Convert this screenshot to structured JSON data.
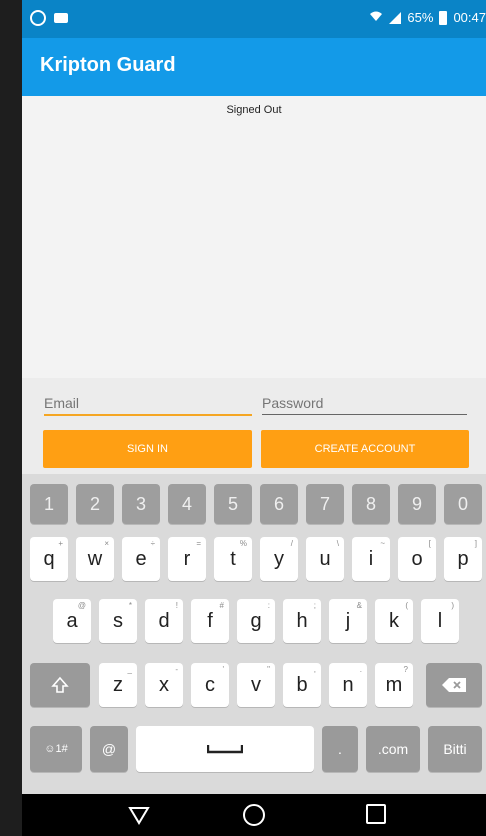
{
  "status_bar": {
    "battery": "65%",
    "time": "00:47"
  },
  "app_bar": {
    "title": "Kripton Guard"
  },
  "content": {
    "status_text": "Signed Out"
  },
  "form": {
    "email_placeholder": "Email",
    "password_placeholder": "Password",
    "sign_in_label": "SIGN IN",
    "create_account_label": "CREATE ACCOUNT"
  },
  "keyboard": {
    "numbers": [
      "1",
      "2",
      "3",
      "4",
      "5",
      "6",
      "7",
      "8",
      "9",
      "0"
    ],
    "row1": [
      {
        "key": "q",
        "hint": "+"
      },
      {
        "key": "w",
        "hint": "×"
      },
      {
        "key": "e",
        "hint": "÷"
      },
      {
        "key": "r",
        "hint": "="
      },
      {
        "key": "t",
        "hint": "%"
      },
      {
        "key": "y",
        "hint": "/"
      },
      {
        "key": "u",
        "hint": "\\"
      },
      {
        "key": "i",
        "hint": "~"
      },
      {
        "key": "o",
        "hint": "["
      },
      {
        "key": "p",
        "hint": "]"
      }
    ],
    "row2": [
      {
        "key": "a",
        "hint": "@"
      },
      {
        "key": "s",
        "hint": "*"
      },
      {
        "key": "d",
        "hint": "!"
      },
      {
        "key": "f",
        "hint": "#"
      },
      {
        "key": "g",
        "hint": ":"
      },
      {
        "key": "h",
        "hint": ";"
      },
      {
        "key": "j",
        "hint": "&"
      },
      {
        "key": "k",
        "hint": "("
      },
      {
        "key": "l",
        "hint": ")"
      }
    ],
    "row3": [
      {
        "key": "z",
        "hint": "_"
      },
      {
        "key": "x",
        "hint": "-"
      },
      {
        "key": "c",
        "hint": "'"
      },
      {
        "key": "v",
        "hint": "\""
      },
      {
        "key": "b",
        "hint": ","
      },
      {
        "key": "n",
        "hint": "."
      },
      {
        "key": "m",
        "hint": "?"
      }
    ],
    "symbols_label": "☺1#",
    "at_label": "@",
    "dotcom_label": ".com",
    "done_label": "Bitti",
    "dot_label": "."
  },
  "colors": {
    "status_bar": "#0a84c7",
    "app_bar": "#139ae8",
    "button": "#ff9f13",
    "email_underline": "#f5a623"
  }
}
